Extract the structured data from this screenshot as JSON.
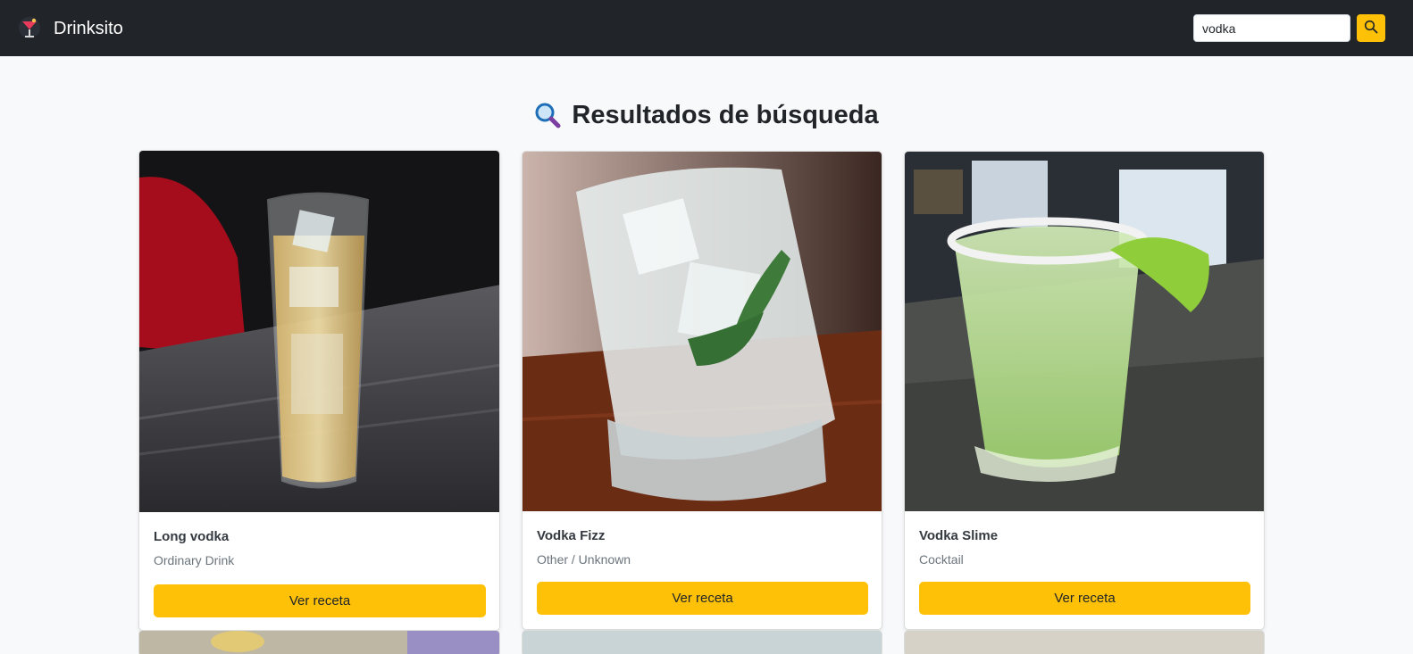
{
  "app": {
    "brand": "Drinksito"
  },
  "search": {
    "value": "vodka"
  },
  "page": {
    "title": "Resultados de búsqueda"
  },
  "results": [
    {
      "name": "Long vodka",
      "category": "Ordinary Drink",
      "button": "Ver receta"
    },
    {
      "name": "Vodka Fizz",
      "category": "Other / Unknown",
      "button": "Ver receta"
    },
    {
      "name": "Vodka Slime",
      "category": "Cocktail",
      "button": "Ver receta"
    }
  ],
  "icons": {
    "brand": "cocktail-logo-icon",
    "search": "search-icon",
    "title": "magnifier-icon"
  },
  "colors": {
    "navbar": "#212529",
    "accent": "#ffc107",
    "background": "#f8f9fa"
  }
}
